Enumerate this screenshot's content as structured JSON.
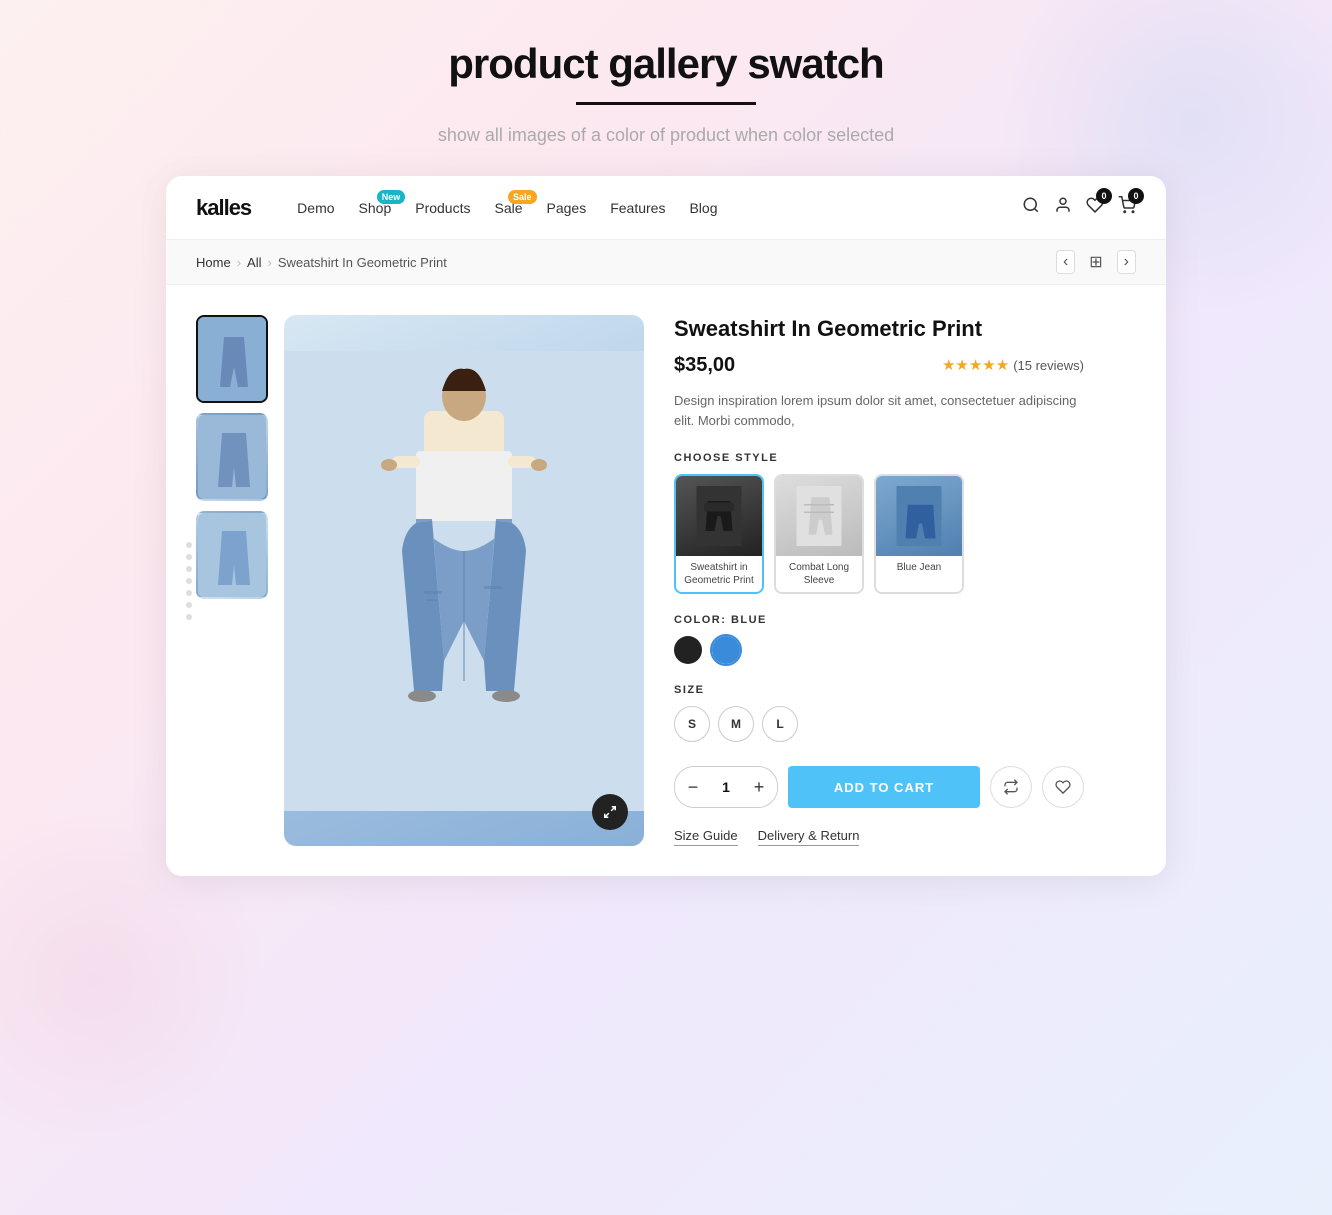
{
  "page": {
    "title": "product gallery swatch",
    "subtitle": "show all images of a color of product when color selected",
    "underline": true
  },
  "nav": {
    "logo": "kalles",
    "links": [
      {
        "label": "Demo",
        "badge": null
      },
      {
        "label": "Shop",
        "badge": "New",
        "badge_type": "new"
      },
      {
        "label": "Products",
        "badge": null
      },
      {
        "label": "Sale",
        "badge": "Sale",
        "badge_type": "sale"
      },
      {
        "label": "Pages",
        "badge": null
      },
      {
        "label": "Features",
        "badge": null
      },
      {
        "label": "Blog",
        "badge": null
      }
    ],
    "icons": {
      "search": "🔍",
      "user": "👤",
      "wishlist_count": "0",
      "cart_count": "0"
    }
  },
  "breadcrumb": {
    "home": "Home",
    "all": "All",
    "current": "Sweatshirt In Geometric Print"
  },
  "product": {
    "title": "Sweatshirt In Geometric Print",
    "price": "$35,00",
    "rating_stars": "★★★★★",
    "review_count": "(15 reviews)",
    "description": "Design inspiration lorem ipsum dolor sit amet, consectetuer adipiscing elit. Morbi commodo,",
    "style_label": "CHOOSE STYLE",
    "styles": [
      {
        "label": "Sweatshirt in\nGeometric Print",
        "selected": true
      },
      {
        "label": "Combat Long Sleeve",
        "selected": false
      },
      {
        "label": "Blue Jean",
        "selected": false
      }
    ],
    "color_label": "COLOR: BLUE",
    "colors": [
      {
        "name": "black",
        "selected": false
      },
      {
        "name": "blue",
        "selected": true
      }
    ],
    "size_label": "SIZE",
    "sizes": [
      "S",
      "M",
      "L"
    ],
    "quantity": 1,
    "add_to_cart": "ADD TO CART",
    "links": [
      {
        "label": "Size Guide"
      },
      {
        "label": "Delivery & Return"
      }
    ]
  }
}
